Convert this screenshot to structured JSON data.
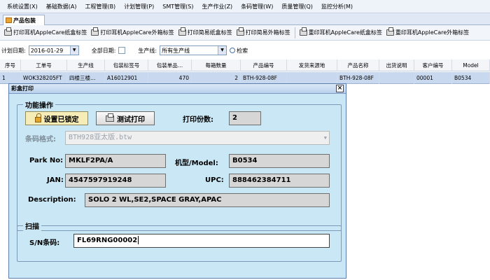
{
  "menu": [
    "系统设置(X)",
    "基础数据(A)",
    "工程管理(B)",
    "计划管理(P)",
    "SMT管理(S)",
    "生产作业(Z)",
    "条码管理(W)",
    "质量管理(Q)",
    "监控分析(M)"
  ],
  "tab": {
    "label": "产品包装"
  },
  "toolbar": [
    "打印耳机AppleCare纸盒标签",
    "打印耳机AppleCare外箱标签",
    "打印简易纸盒标签",
    "打印简易外箱标签",
    "重印耳机AppleCare纸盒标签",
    "重印耳机AppleCare外箱标签"
  ],
  "filter": {
    "date_label": "计划日期:",
    "date_value": "2016-01-29",
    "all_dates_label": "全部日期:",
    "line_label": "生产线:",
    "line_value": "所有生产线",
    "search_label": "检索"
  },
  "grid": {
    "columns": [
      "序号",
      "工单号",
      "生产线",
      "包装标签号",
      "包装单品…",
      "每箱数量",
      "产品编号",
      "发货来源地",
      "产品名称",
      "出货说明",
      "客户编号",
      "Model"
    ],
    "rows": [
      [
        "1",
        "WOK328205FT",
        "四楼三楼…",
        "A16012901",
        "470",
        "2",
        "BTH-928-08F",
        "",
        "BTH-928-08F",
        "",
        "00001",
        "B0534"
      ]
    ]
  },
  "dialog": {
    "title": "彩盒打印",
    "function_group": "功能操作",
    "lock_button": "设置已锁定",
    "test_print_button": "测试打印",
    "copies_label": "打印份数:",
    "copies_value": "2",
    "barcode_format_label": "条码格式:",
    "barcode_format_value": "BTH928亚太版.btw",
    "park_no_label": "Park No:",
    "park_no_value": "MKLF2PA/A",
    "model_label": "机型/Model:",
    "model_value": "B0534",
    "jan_label": "JAN:",
    "jan_value": "4547597919248",
    "upc_label": "UPC:",
    "upc_value": "888462384711",
    "description_label": "Description:",
    "description_value": "SOLO 2 WL,SE2,SPACE GRAY,APAC",
    "scan_group": "扫描",
    "sn_label": "S/N条码:",
    "sn_value": "FL69RNG00002"
  }
}
